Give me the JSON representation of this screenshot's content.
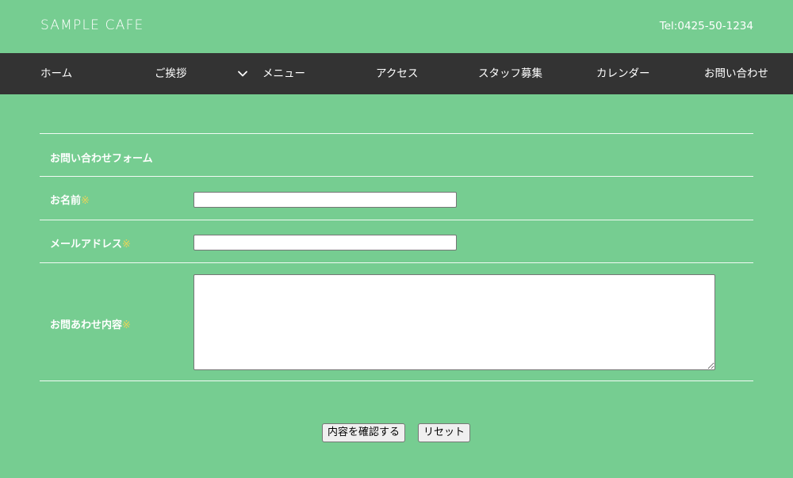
{
  "site": {
    "logo": "SAMPLE CAFE",
    "tel": "Tel:0425-50-1234"
  },
  "nav": {
    "items": [
      {
        "label": "ホーム"
      },
      {
        "label": "ご挨拶"
      },
      {
        "label": "メニュー"
      },
      {
        "label": "アクセス"
      },
      {
        "label": "スタッフ募集"
      },
      {
        "label": "カレンダー"
      },
      {
        "label": "お問い合わせ"
      }
    ],
    "dropdown_icon": "chevron-down-icon"
  },
  "form": {
    "title": "お問い合わせフォーム",
    "required_mark": "※",
    "required_color": "#e8d35a",
    "fields": {
      "name": {
        "label": "お名前",
        "value": ""
      },
      "email": {
        "label": "メールアドレス",
        "value": ""
      },
      "message": {
        "label": "お問あわせ内容",
        "value": ""
      }
    },
    "buttons": {
      "confirm": "内容を確認する",
      "reset": "リセット"
    }
  },
  "colors": {
    "background": "#76cd91",
    "navbar": "#333333"
  }
}
